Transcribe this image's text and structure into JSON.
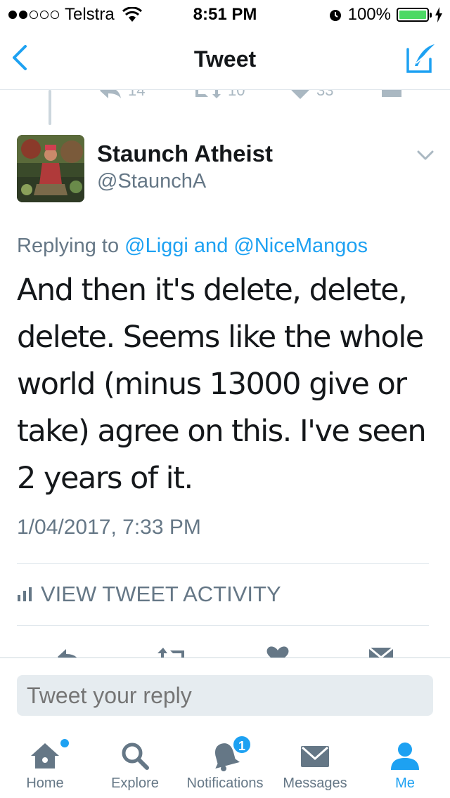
{
  "status_bar": {
    "carrier": "Telstra",
    "time": "8:51 PM",
    "battery": "100%"
  },
  "nav": {
    "title": "Tweet"
  },
  "previous_tweet": {
    "replies": "14",
    "retweets": "10",
    "likes": "33"
  },
  "tweet": {
    "name": "Staunch Atheist",
    "handle": "@StaunchA",
    "replying_prefix": "Replying to ",
    "reply_to_1": "@Liggi",
    "reply_joiner": " and ",
    "reply_to_2": "@NiceMangos",
    "text": "And then it's delete, delete, delete. Seems like the whole world (minus 13000 give or take) agree on this. I've seen 2 years of it.",
    "timestamp": "1/04/2017, 7:33 PM",
    "activity_label": "VIEW TWEET ACTIVITY"
  },
  "reply": {
    "placeholder": "Tweet your reply"
  },
  "tabs": [
    {
      "label": "Home",
      "icon": "home-icon"
    },
    {
      "label": "Explore",
      "icon": "search-icon"
    },
    {
      "label": "Notifications",
      "icon": "bell-icon",
      "badge": "1"
    },
    {
      "label": "Messages",
      "icon": "envelope-icon"
    },
    {
      "label": "Me",
      "icon": "person-icon",
      "active": true
    }
  ],
  "colors": {
    "accent": "#1da1f2",
    "muted": "#657786",
    "text": "#14171a",
    "battery": "#4cd964"
  }
}
